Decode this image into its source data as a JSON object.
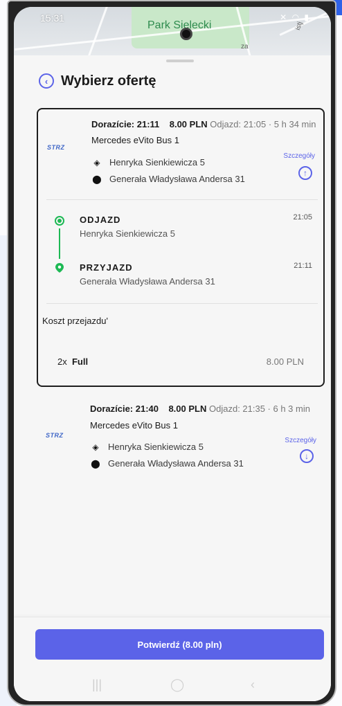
{
  "status_bar": {
    "time": "15:31"
  },
  "map": {
    "park_label": "Park Sielecki",
    "street_label_1": "za",
    "street_label_2": "istj"
  },
  "header": {
    "title": "Wybierz ofertę"
  },
  "offers": [
    {
      "logo": "STRZ",
      "departure_label": "Dorazície: 21:11",
      "price": "8.00 PLN",
      "schedule": "Odjazd: 21:05 · 5 h 34 min",
      "vehicle": "Mercedes eVito Bus 1",
      "from": "Henryka Sienkiewicza 5",
      "to": "Generała Władysława Andersa 31",
      "details_label": "Szczegóły",
      "details_icon": "arrow-up-circle-icon",
      "expanded": true,
      "segments": [
        {
          "title": "ODJAZD",
          "address": "Henryka Sienkiewicza 5",
          "time": "21:05"
        },
        {
          "title": "PRZYJAZD",
          "address": "Generała Władysława Andersa 31",
          "time": "21:11"
        }
      ],
      "cost_label": "Koszt przejazdu'",
      "ticket_qty": "2x",
      "ticket_type": "Full",
      "ticket_price": "8.00 PLN"
    },
    {
      "logo": "STRZ",
      "departure_label": "Dorazície: 21:40",
      "price": "8.00 PLN",
      "schedule": "Odjazd: 21:35 · 6 h 3 min",
      "vehicle": "Mercedes eVito Bus 1",
      "from": "Henryka Sienkiewicza 5",
      "to": "Generała Władysława Andersa 31",
      "details_label": "Szczegóły",
      "details_icon": "arrow-down-circle-icon",
      "expanded": false
    }
  ],
  "footer": {
    "confirm_label": "Potwierdź (8.00 pln)"
  },
  "colors": {
    "accent": "#5b63e8",
    "timeline_green": "#1db954",
    "background": "#f6f6f6"
  }
}
